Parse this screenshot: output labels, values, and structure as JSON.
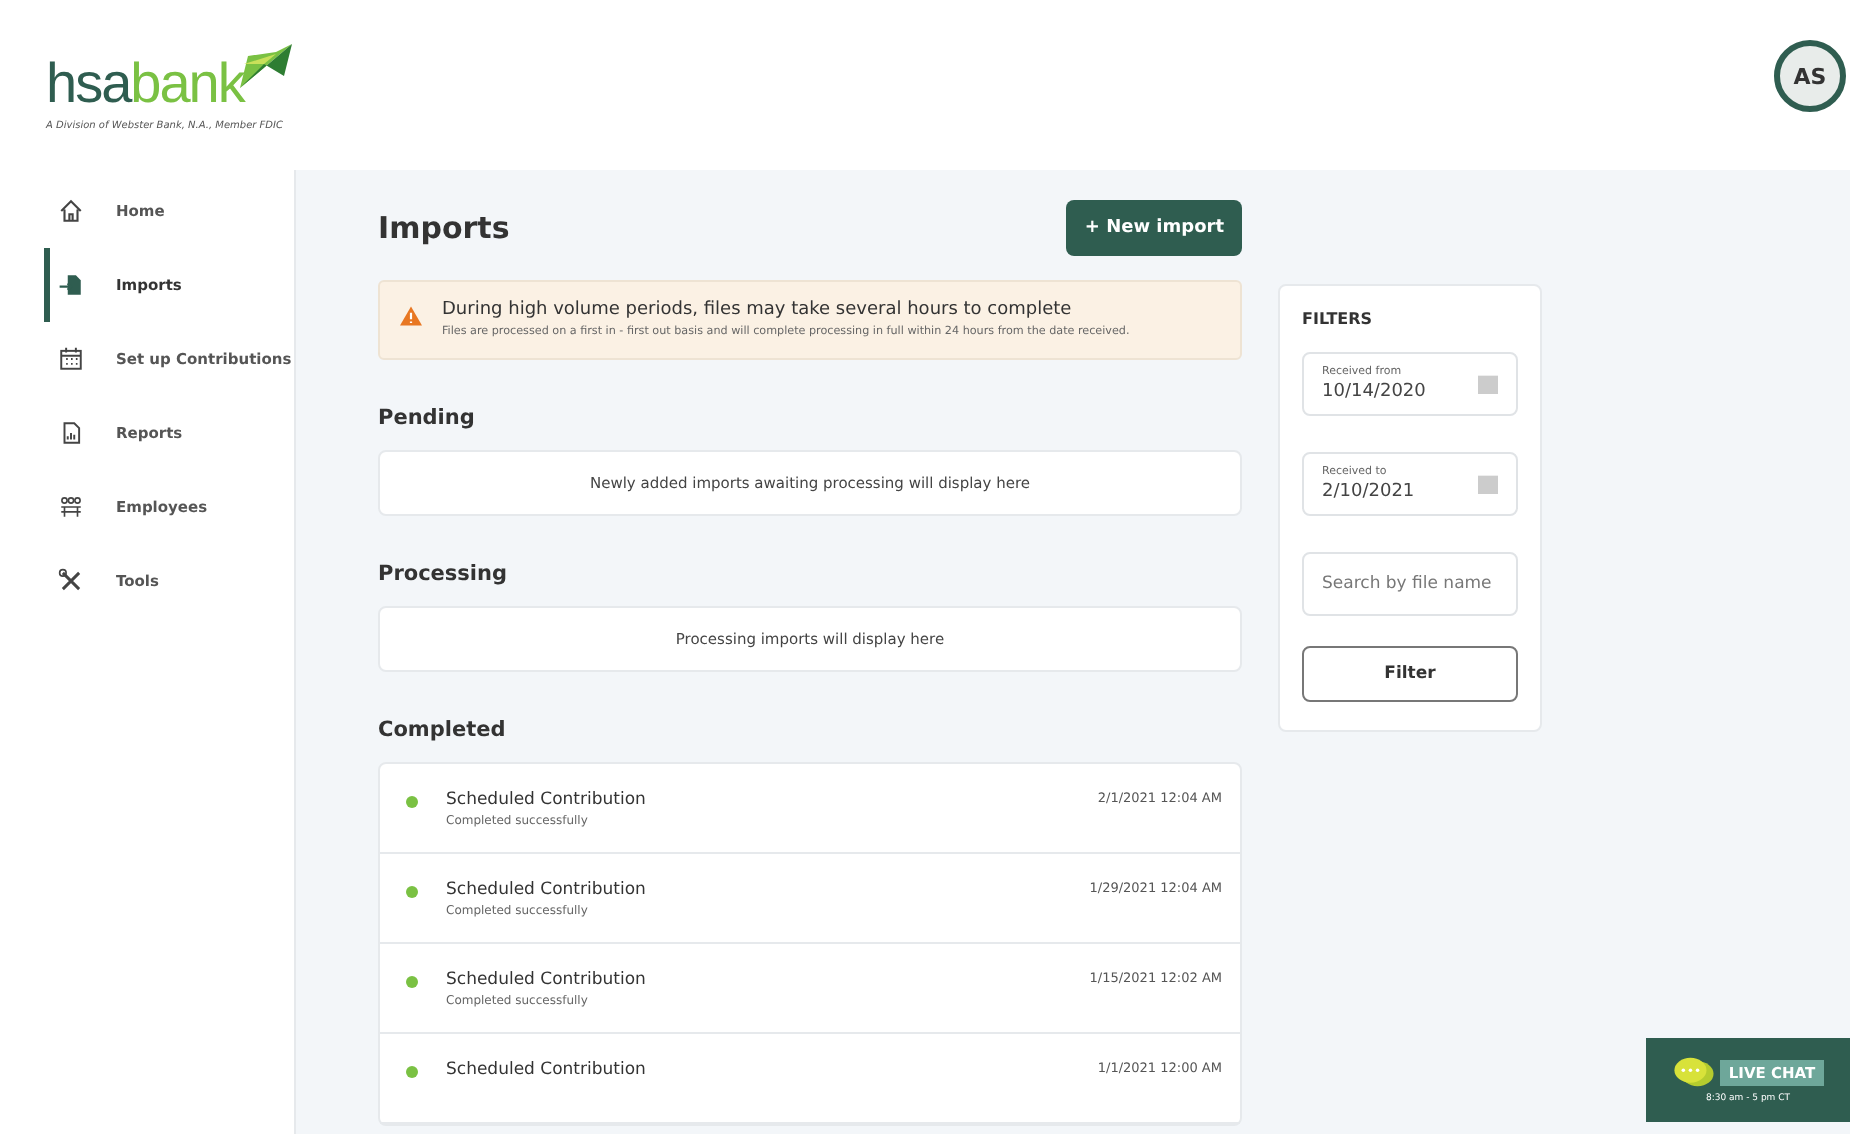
{
  "header": {
    "logo_main": "hsa",
    "logo_accent": "bank",
    "logo_tagline": "A Division of Webster Bank, N.A., Member FDIC",
    "avatar": "AS"
  },
  "sidebar": {
    "items": [
      {
        "label": "Home",
        "selected": false
      },
      {
        "label": "Imports",
        "selected": true
      },
      {
        "label": "Set up Contributions",
        "selected": false
      },
      {
        "label": "Reports",
        "selected": false
      },
      {
        "label": "Employees",
        "selected": false
      },
      {
        "label": "Tools",
        "selected": false
      }
    ]
  },
  "page": {
    "title": "Imports",
    "new_button": "+ New import"
  },
  "alert": {
    "title": "During high volume periods, files may take several hours to complete",
    "body": "Files are processed on a first in - first out basis and will complete processing in full within 24 hours from the date received."
  },
  "sections": [
    {
      "title": "Pending",
      "empty": "Newly added imports awaiting processing will display here"
    },
    {
      "title": "Processing",
      "empty": "Processing imports will display here"
    }
  ],
  "completed": {
    "title": "Completed",
    "items": [
      {
        "name": "Scheduled Contribution",
        "status": "Completed successfully",
        "date": "2/1/2021 12:04 AM",
        "color": "#7ac143"
      },
      {
        "name": "Scheduled Contribution",
        "status": "Completed successfully",
        "date": "1/29/2021 12:04 AM",
        "color": "#7ac143"
      },
      {
        "name": "Scheduled Contribution",
        "status": "Completed successfully",
        "date": "1/15/2021 12:02 AM",
        "color": "#7ac143"
      },
      {
        "name": "Scheduled Contribution",
        "date": "1/1/2021 12:00 AM",
        "color": "#7ac143"
      }
    ]
  },
  "filters": {
    "title": "FILTERS",
    "fields": [
      {
        "label": "Received from",
        "value": "10/14/2020"
      },
      {
        "label": "Received to",
        "value": "2/10/2021"
      }
    ],
    "search": {
      "placeholder": "Search by file name"
    },
    "button": "Filter"
  },
  "live_chat": {
    "label": "LIVE CHAT",
    "hours": "8:30 am - 5 pm CT"
  }
}
